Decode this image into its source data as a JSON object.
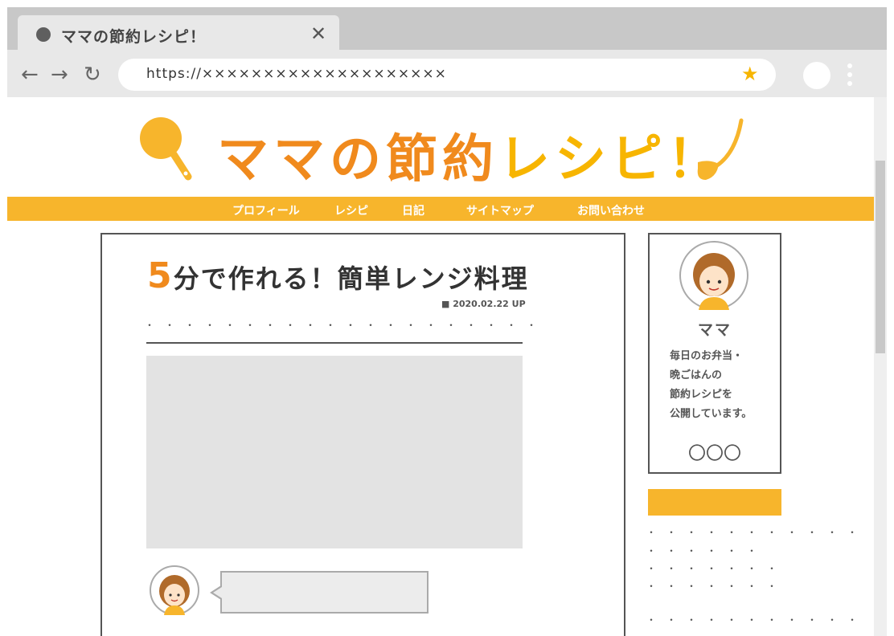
{
  "browser": {
    "tab_title": "ママの節約レシピ！",
    "tab_close": "✕",
    "back": "←",
    "forward": "→",
    "reload": "↻",
    "url": "https://××××××××××××××××××××",
    "bookmark_star": "★",
    "icons": [
      "favicon-dot",
      "close-icon",
      "back-arrow-icon",
      "forward-arrow-icon",
      "reload-icon",
      "star-icon",
      "profile-icon",
      "kebab-menu-icon"
    ]
  },
  "site": {
    "title_part1": "ママの",
    "title_part2": "節約",
    "title_part3": "レシピ！",
    "nav": [
      "プロフィール",
      "レシピ",
      "日記",
      "サイトマップ",
      "お問い合わせ"
    ],
    "colors": {
      "orange": "#f08a1d",
      "yellow": "#f7b52c"
    }
  },
  "article": {
    "title_num": "5",
    "title_rest": "分で作れる！簡単レンジ料理",
    "date": "■ 2020.02.22 UP",
    "dots": "・・・・・・・・・・・・・・・・・・・・"
  },
  "sidebar": {
    "name": "ママ",
    "desc": [
      "毎日のお弁当・",
      "晩ごはんの",
      "節約レシピを",
      "公開しています。"
    ],
    "circles": "〇〇〇",
    "list_dots": [
      "・・・・・・・・・・・",
      "・・・・・・",
      "・・・・・・・",
      "・・・・・・・",
      "・・・・・・・・・・・"
    ]
  }
}
